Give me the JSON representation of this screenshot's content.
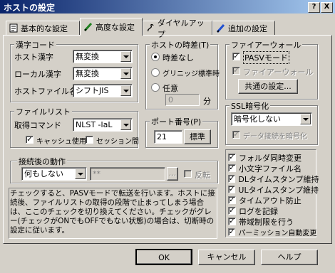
{
  "window": {
    "title": "ホストの設定",
    "help_label": "?",
    "close_label": "X"
  },
  "tabs": [
    {
      "label": "基本的な設定"
    },
    {
      "label": "高度な設定"
    },
    {
      "label": "ダイヤルアップ"
    },
    {
      "label": "追加の設定"
    }
  ],
  "kanji": {
    "title": "漢字コード",
    "host_label": "ホスト漢字",
    "host_value": "無変換",
    "local_label": "ローカル漢字",
    "local_value": "無変換",
    "filename_label": "ホストファイル名",
    "filename_value": "シフトJIS"
  },
  "timezone": {
    "title": "ホストの時差(T)",
    "opt_none": "時差なし",
    "opt_gmt": "グリニッジ標準時",
    "opt_custom": "任意",
    "value": "0",
    "unit": "分"
  },
  "firewall": {
    "title": "ファイアーウォール",
    "pasv": "PASVモード",
    "fw": "ファイアーウォール",
    "common_button": "共通の設定..."
  },
  "filelist": {
    "title": "ファイルリスト",
    "cmd_label": "取得コマンド",
    "cmd_value": "NLST -laL",
    "cache": "キャッシュ使用",
    "session": "セッション間"
  },
  "port": {
    "title": "ポート番号(P)",
    "value": "21",
    "default_button": "標準"
  },
  "ssl": {
    "title": "SSL暗号化",
    "value": "暗号化しない",
    "data_encrypt": "データ接続を暗号化"
  },
  "after": {
    "title": "接続後の動作",
    "value": "何もしない",
    "path": "**",
    "browse": "...",
    "reverse": "反転"
  },
  "description": "チェックすると、PASVモードで転送を行います。ホストに接続後、ファイルリストの取得の段階で止まってしまう場合は、ここのチェックを切り換えてください。チェックがグレー(チェックがONでもOFFでもない状態)の場合は、切断時の設定に従います。",
  "options": [
    {
      "label": "フォルダ同時変更"
    },
    {
      "label": "小文字ファイル名"
    },
    {
      "label": "DLタイムスタンプ維持"
    },
    {
      "label": "ULタイムスタンプ維持"
    },
    {
      "label": "タイムアウト防止"
    },
    {
      "label": "ログを記録"
    },
    {
      "label": "帯域制限を行う"
    },
    {
      "label": "パーミッション自動変更"
    }
  ],
  "footer": {
    "ok": "OK",
    "cancel": "キャンセル",
    "help": "ヘルプ"
  }
}
